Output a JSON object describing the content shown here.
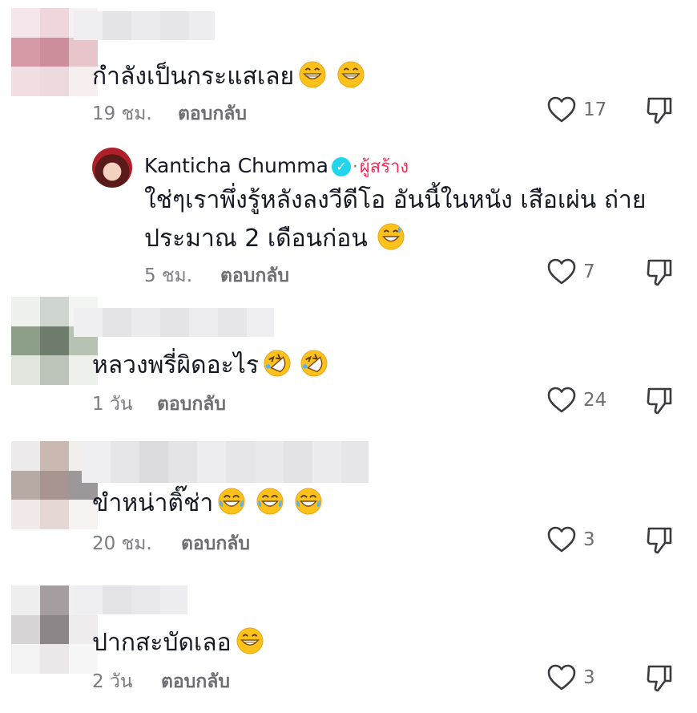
{
  "comments": [
    {
      "text": "กำลังเป็นกระแสเลย",
      "emojis": [
        "grin",
        "grin"
      ],
      "time": "19 ชม.",
      "reply": "ตอบกลับ",
      "likes": "17"
    },
    {
      "author": "Kanticha Chumma",
      "separator": "·",
      "badge": "ผู้สร้าง",
      "line1": "ใช่ๆเราพึ่งรู้หลังลงวีดีโอ อันนี้ในหนัง เสือเผ่น ถ่าย",
      "line2": "ประมาณ 2 เดือนก่อน",
      "emojis": [
        "sweat-smile"
      ],
      "time": "5 ชม.",
      "reply": "ตอบกลับ",
      "likes": "7"
    },
    {
      "text": "หลวงพรี่ผิดอะไร",
      "emojis": [
        "rofl",
        "rofl"
      ],
      "time": "1 วัน",
      "reply": "ตอบกลับ",
      "likes": "24"
    },
    {
      "text": "ขำหน่าติ๊ช่า",
      "emojis": [
        "joy",
        "joy",
        "joy"
      ],
      "time": "20 ชม.",
      "reply": "ตอบกลับ",
      "likes": "3"
    },
    {
      "text": "ปากสะบัดเลอ",
      "emojis": [
        "grin"
      ],
      "time": "2 วัน",
      "reply": "ตอบกลับ",
      "likes": "3"
    }
  ],
  "colors": {
    "text": "#161823",
    "meta": "#7c7c80",
    "creator": "#fe2c55",
    "verified": "#20d5ec"
  },
  "icons": [
    "heart-outline-icon",
    "thumb-down-icon",
    "verified-check-icon"
  ]
}
